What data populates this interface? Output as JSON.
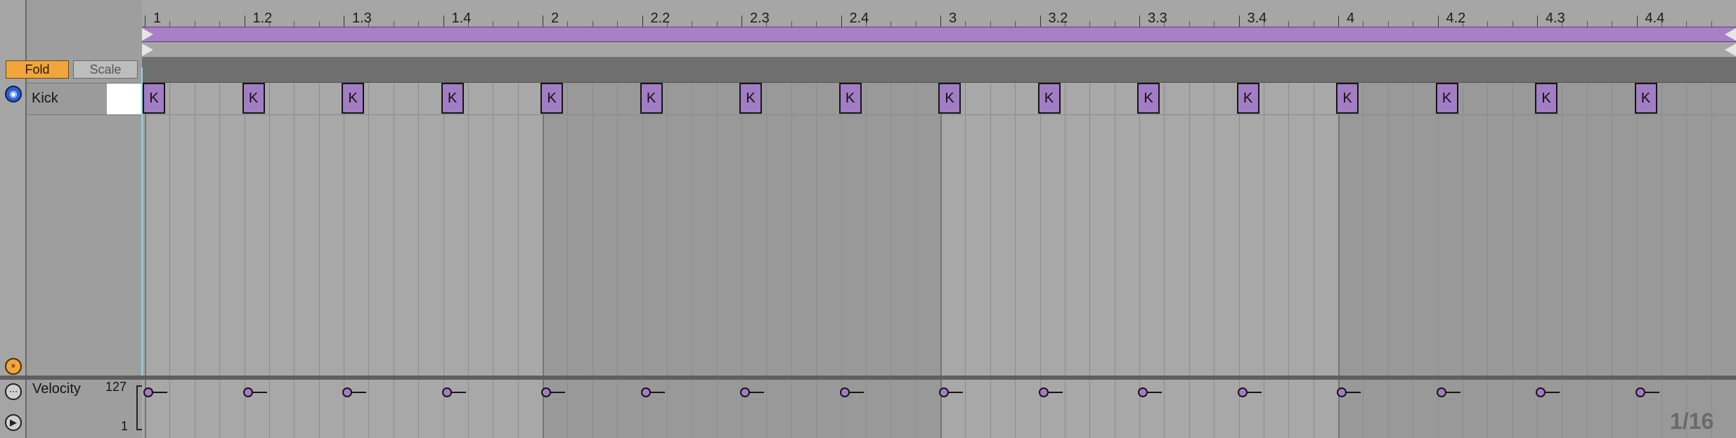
{
  "ruler": {
    "bar_labels": [
      "1",
      "1.2",
      "1.3",
      "1.4",
      "2",
      "2.2",
      "2.3",
      "2.4",
      "3",
      "3.2",
      "3.3",
      "3.4",
      "4",
      "4.2",
      "4.3",
      "4.4"
    ]
  },
  "toolbar": {
    "fold_label": "Fold",
    "scale_label": "Scale"
  },
  "track": {
    "name": "Kick",
    "note_label": "K",
    "note_count": 16
  },
  "velocity": {
    "label": "Velocity",
    "max": "127",
    "min": "1"
  },
  "grid": {
    "quantization": "1/16"
  },
  "colors": {
    "clip": "#a97fc6",
    "note": "#a27dc4",
    "fold_active": "#f0a63a",
    "playhead": "#7fd7ee",
    "headphones": "#2c5fd6"
  },
  "icons": {
    "preview": "headphones-icon",
    "fold_keys": "key-icon",
    "velocity_options": "more-dots-icon",
    "play": "play-icon"
  }
}
